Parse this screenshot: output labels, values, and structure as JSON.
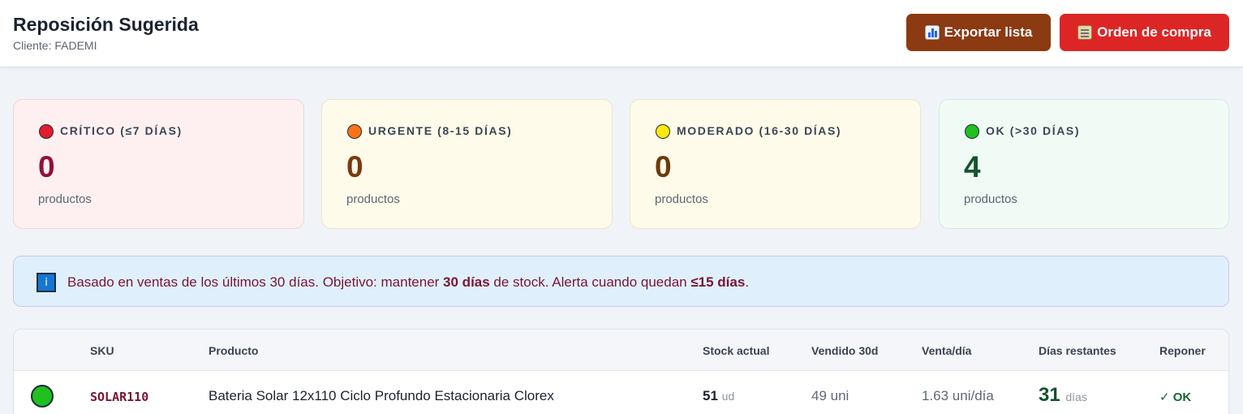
{
  "header": {
    "title": "Reposición Sugerida",
    "subtitle": "Cliente: FADEMI",
    "export_label": "Exportar lista",
    "order_label": "Orden de compra"
  },
  "summary": [
    {
      "label": "CRÍTICO (≤7 DÍAS)",
      "count": "0",
      "unit": "productos",
      "dot_color": "#e11d2e",
      "count_color": "#8f1239"
    },
    {
      "label": "URGENTE (8-15 DÍAS)",
      "count": "0",
      "unit": "productos",
      "dot_color": "#f97316",
      "count_color": "#7c3a0e"
    },
    {
      "label": "MODERADO (16-30 DÍAS)",
      "count": "0",
      "unit": "productos",
      "dot_color": "#fde711",
      "count_color": "#6b3a0f"
    },
    {
      "label": "OK (>30 DÍAS)",
      "count": "4",
      "unit": "productos",
      "dot_color": "#22c01f",
      "count_color": "#14532d"
    }
  ],
  "info": {
    "icon": "info-icon",
    "text_1": "Basado en ventas de los últimos 30 días. Objetivo: mantener ",
    "bold_1": "30 días",
    "text_2": " de stock. Alerta cuando quedan ",
    "bold_2": "≤15 días",
    "text_3": "."
  },
  "table": {
    "columns": [
      "",
      "SKU",
      "Producto",
      "Stock actual",
      "Vendido 30d",
      "Venta/día",
      "Días restantes",
      "Reponer"
    ],
    "rows": [
      {
        "status_color": "#1fc01f",
        "sku": "SOLAR110",
        "product": "Bateria Solar 12x110 Ciclo Profundo Estacionaria Clorex",
        "stock": "51",
        "stock_unit": "ud",
        "sold_30d": "49 uni",
        "per_day": "1.63 uni/día",
        "days_left": "31",
        "days_unit": "días",
        "reorder": "✓ OK"
      }
    ]
  }
}
